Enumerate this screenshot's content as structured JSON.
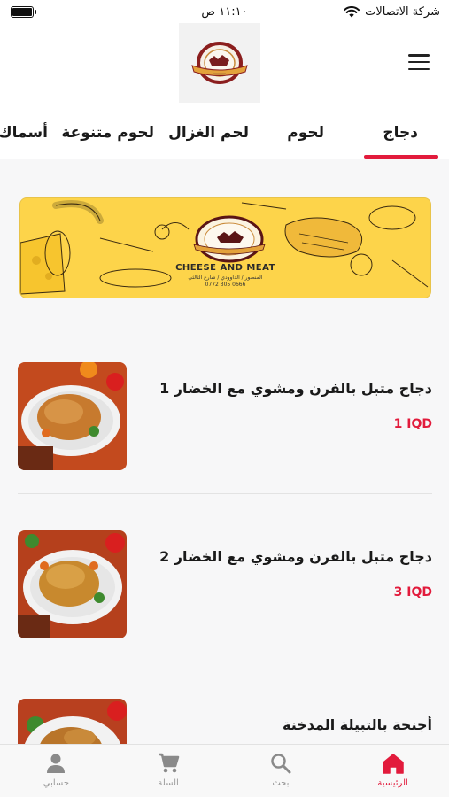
{
  "status_bar": {
    "carrier": "شركة الاتصالات",
    "time": "١١:١٠ ص"
  },
  "header": {
    "logo_icon": "cheese-and-meat-logo",
    "menu_icon": "hamburger-menu-icon"
  },
  "tabs": [
    {
      "label": "دجاج",
      "active": true
    },
    {
      "label": "لحوم",
      "active": false
    },
    {
      "label": "لحم الغزال",
      "active": false
    },
    {
      "label": "لحوم متنوعة",
      "active": false
    },
    {
      "label": "أسماك",
      "active": false
    }
  ],
  "banner": {
    "brand_name": "CHEESE AND MEAT",
    "address": "المنصور / الداوودي / شارع الثالثي",
    "phone": "0772 305 0666"
  },
  "products": [
    {
      "title": "دجاج متبل بالفرن ومشوي مع الخضار 1",
      "price": "1 IQD"
    },
    {
      "title": "دجاج متبل بالفرن ومشوي مع الخضار 2",
      "price": "3 IQD"
    },
    {
      "title": "أجنحة بالتبيلة المدخنة",
      "price": ""
    }
  ],
  "bottom_nav": [
    {
      "label": "الرئيسية",
      "icon": "home-icon",
      "active": true
    },
    {
      "label": "بحث",
      "icon": "search-icon",
      "active": false
    },
    {
      "label": "السلة",
      "icon": "cart-icon",
      "active": false
    },
    {
      "label": "حسابي",
      "icon": "user-icon",
      "active": false
    }
  ],
  "colors": {
    "accent": "#e21b3c",
    "banner_bg": "#fdd44a",
    "page_bg": "#f7f7f8"
  }
}
